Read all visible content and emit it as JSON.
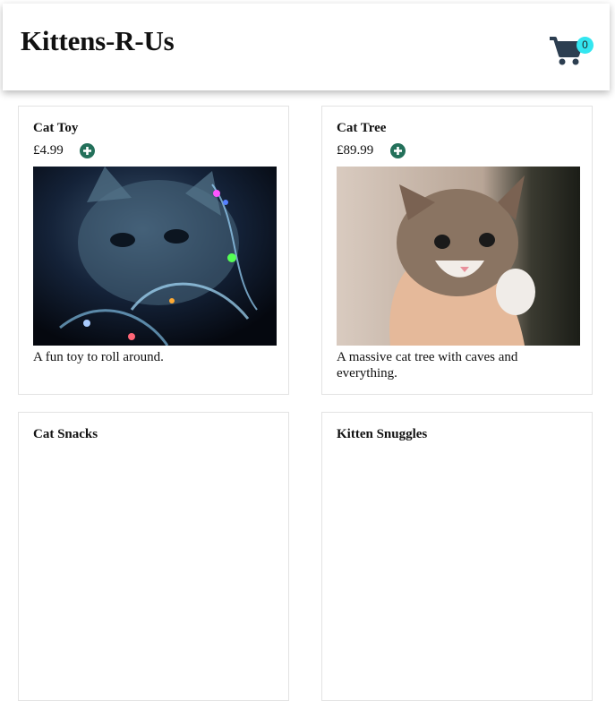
{
  "header": {
    "title": "Kittens-R-Us",
    "cart_count": "0"
  },
  "products": [
    {
      "name": "Cat Toy",
      "price": "£4.99",
      "description": "A fun toy to roll around."
    },
    {
      "name": "Cat Tree",
      "price": "£89.99",
      "description": "A massive cat tree with caves and everything."
    },
    {
      "name": "Cat Snacks"
    },
    {
      "name": "Kitten Snuggles"
    }
  ],
  "colors": {
    "cart_icon": "#2c3e50",
    "cart_badge": "#33e6f0",
    "add_icon": "#23705a",
    "card_border": "#e3e3e3"
  },
  "icons": {
    "cart": "shopping-cart-icon",
    "add": "plus-circle-icon"
  }
}
